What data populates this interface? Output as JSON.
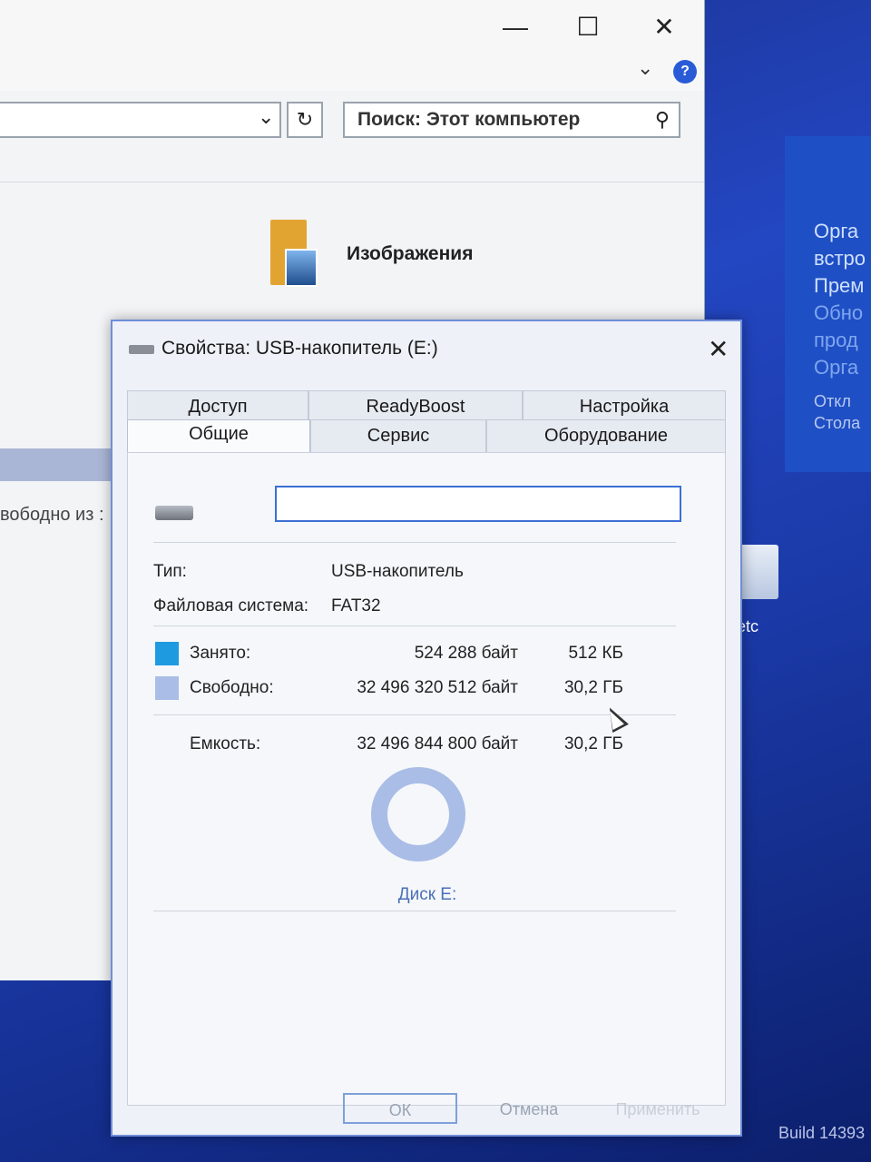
{
  "explorer": {
    "search_placeholder": "Поиск: Этот компьютер",
    "folder_label": "Изображения",
    "left_free_text": "вободно из :",
    "minimize": "—",
    "maximize": "☐",
    "close": "✕"
  },
  "desktop": {
    "notif_lines": [
      "Орга",
      "встро",
      "Прем"
    ],
    "notif_links": [
      "Обно",
      "прод",
      "Орга"
    ],
    "notif_small": [
      "Откл",
      "Стола"
    ],
    "icon_label": "etc",
    "build": "Build 14393"
  },
  "dialog": {
    "title": "Свойства: USB-накопитель (E:)",
    "tabs_row1": [
      "Доступ",
      "ReadyBoost",
      "Настройка"
    ],
    "tabs_row2": [
      "Общие",
      "Сервис",
      "Оборудование"
    ],
    "type_label": "Тип:",
    "type_value": "USB-накопитель",
    "fs_label": "Файловая система:",
    "fs_value": "FAT32",
    "used_label": "Занято:",
    "used_bytes": "524 288 байт",
    "used_hr": "512 КБ",
    "free_label": "Свободно:",
    "free_bytes": "32 496 320 512 байт",
    "free_hr": "30,2 ГБ",
    "capacity_label": "Емкость:",
    "capacity_bytes": "32 496 844 800 байт",
    "capacity_hr": "30,2 ГБ",
    "disk_label": "Диск E:",
    "ok": "ОК",
    "cancel": "Отмена",
    "apply": "Применить",
    "used_color": "#1e9be0",
    "free_color": "#a9bde6"
  }
}
